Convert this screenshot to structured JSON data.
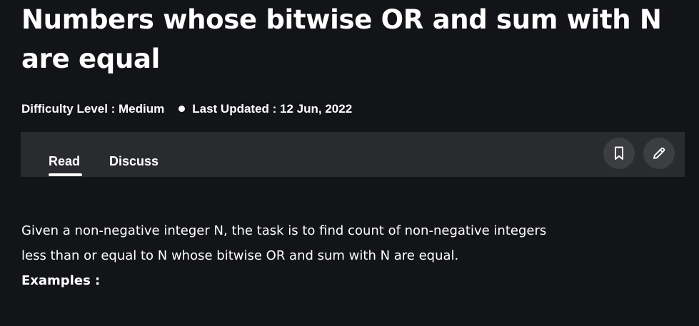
{
  "article": {
    "title": "Numbers whose bitwise OR and sum with N are equal",
    "difficulty": "Difficulty Level : Medium",
    "last_updated": "Last Updated : 12 Jun, 2022"
  },
  "tabs": {
    "read_label": "Read",
    "discuss_label": "Discuss",
    "active": "Read"
  },
  "actions": {
    "bookmark_icon": "bookmark-icon",
    "edit_icon": "pencil-icon"
  },
  "content": {
    "paragraph_line1": "Given a non-negative integer N, the task is to find count of non-negative integers",
    "paragraph_line2": "less than or equal to N whose bitwise OR and sum with N are equal.",
    "examples_heading": "Examples :"
  },
  "colors": {
    "background": "#131417",
    "tabbar": "#2a2b2e",
    "icon_button": "#3d3e41",
    "text": "#ffffff"
  }
}
